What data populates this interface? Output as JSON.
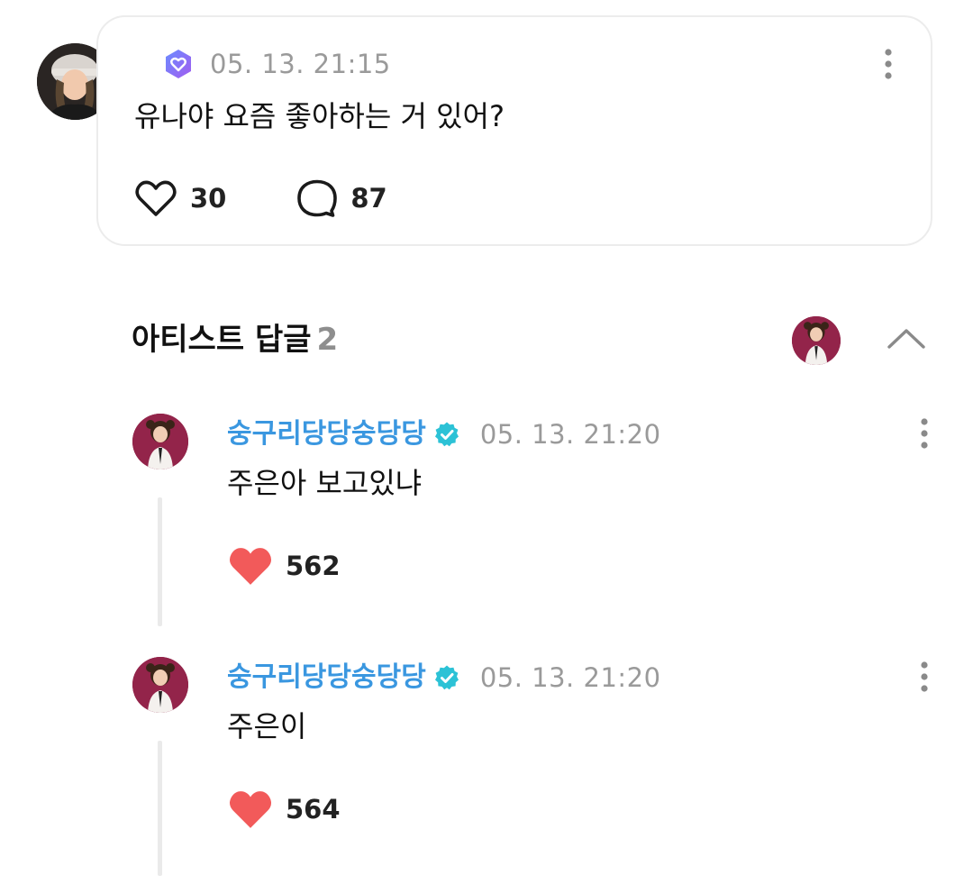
{
  "post": {
    "date": "05. 13. 21:15",
    "text": "유나야 요즘 좋아하는 거 있어?",
    "likes": "30",
    "comments": "87",
    "icons": {
      "badge": "membership-heart-badge-icon",
      "more": "more-vertical-icon",
      "like": "heart-outline-icon",
      "comment": "speech-bubble-icon"
    }
  },
  "artist_replies": {
    "title": "아티스트 답글",
    "count": "2",
    "collapse_icon": "chevron-up-icon"
  },
  "replies": [
    {
      "name": "숭구리당당숭당당",
      "date": "05. 13. 21:20",
      "text": "주은아 보고있냐",
      "likes": "562"
    },
    {
      "name": "숭구리당당숭당당",
      "date": "05. 13. 21:20",
      "text": "주은이",
      "likes": "564"
    }
  ],
  "colors": {
    "artist_name": "#3a97e0",
    "verified_badge": "#2cc2d6",
    "like_heart": "#f25a5a",
    "date_gray": "#9a9a9a",
    "card_border": "#ececec"
  }
}
